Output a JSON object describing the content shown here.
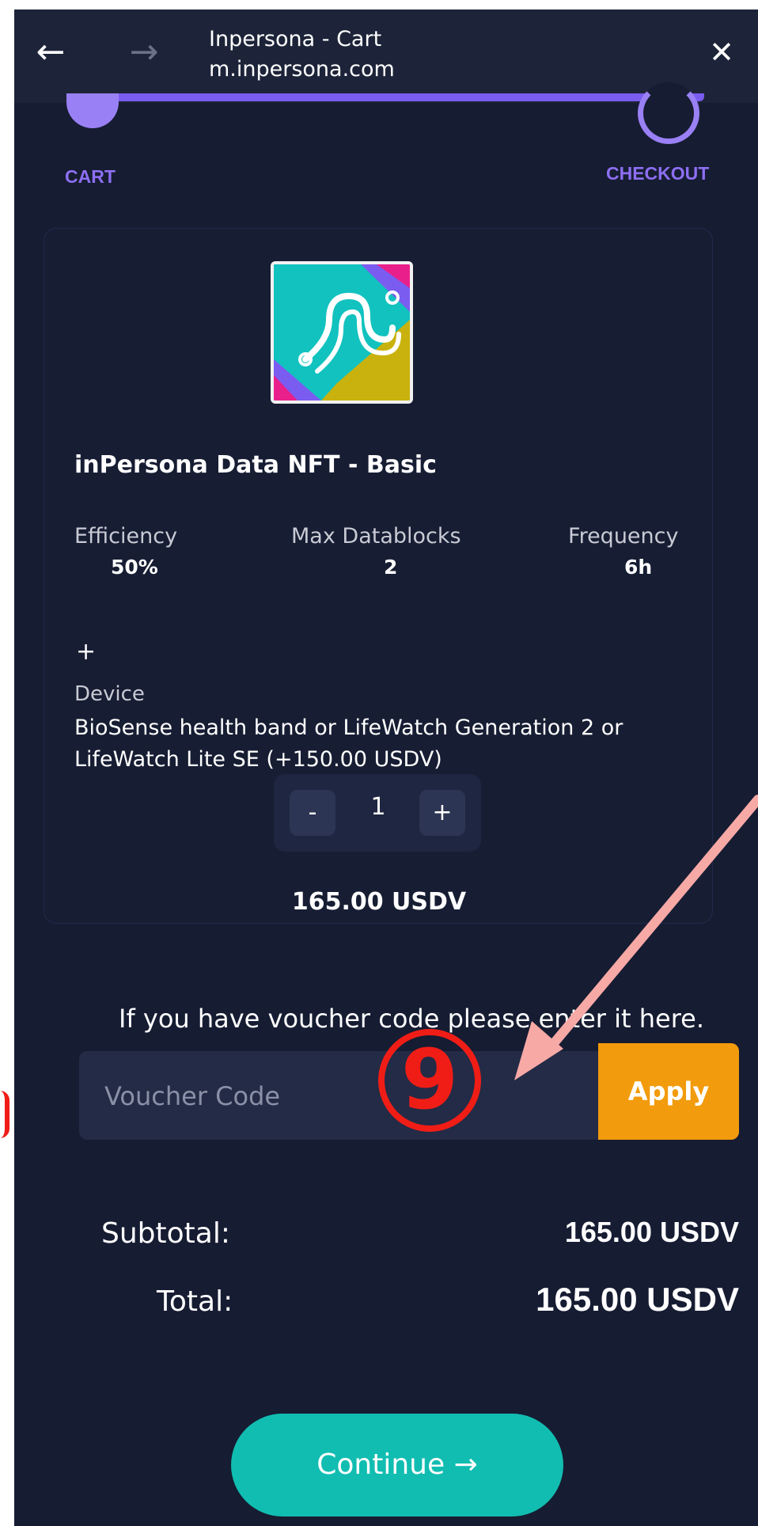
{
  "browser": {
    "title": "Inpersona - Cart",
    "url": "m.inpersona.com",
    "back_icon": "←",
    "forward_icon": "→",
    "close_icon": "✕"
  },
  "steps": {
    "left": "CART",
    "right": "CHECKOUT"
  },
  "product": {
    "name": "inPersona Data NFT - Basic",
    "stats": [
      {
        "label": "Efficiency",
        "value": "50%"
      },
      {
        "label": "Max Datablocks",
        "value": "2"
      },
      {
        "label": "Frequency",
        "value": "6h"
      }
    ],
    "plus": "+",
    "device_label": "Device",
    "device_text": "BioSense health band or LifeWatch Generation 2 or LifeWatch Lite SE (+150.00 USDV)",
    "quantity": "1",
    "minus_label": "-",
    "plus_label": "+",
    "price": "165.00 USDV"
  },
  "voucher": {
    "hint": "If you have voucher code please enter it here.",
    "placeholder": "Voucher Code",
    "apply_label": "Apply"
  },
  "summary": {
    "subtotal_label": "Subtotal:",
    "subtotal_value": "165.00 USDV",
    "total_label": "Total:",
    "total_value": "165.00 USDV"
  },
  "continue_label": "Continue →",
  "annotation": {
    "number": "9"
  },
  "colors": {
    "background": "#161c32",
    "accent_purple": "#8d6ff2",
    "apply_orange": "#f29b0c",
    "continue_teal": "#11bdb1",
    "annotation_red": "#f01d17",
    "arrow_pink": "#f7a9a6"
  }
}
